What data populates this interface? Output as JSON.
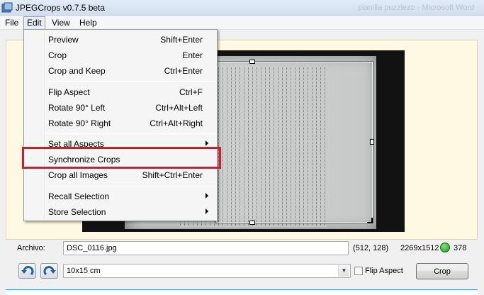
{
  "window": {
    "title": "JPEGCrops v0.7.5 beta",
    "background_title": "planilla puzzlezo - Microsoft Word"
  },
  "menubar": {
    "items": [
      "File",
      "Edit",
      "View",
      "Help"
    ],
    "active": "Edit"
  },
  "edit_menu": {
    "items": [
      {
        "label": "Preview",
        "shortcut": "Shift+Enter"
      },
      {
        "label": "Crop",
        "shortcut": "Enter"
      },
      {
        "label": "Crop and Keep",
        "shortcut": "Ctrl+Enter"
      },
      {
        "label": "Flip Aspect",
        "shortcut": "Ctrl+F"
      },
      {
        "label": "Rotate 90° Left",
        "shortcut": "Ctrl+Alt+Left"
      },
      {
        "label": "Rotate 90° Right",
        "shortcut": "Ctrl+Alt+Right"
      },
      {
        "label": "Set all Aspects",
        "submenu": true
      },
      {
        "label": "Synchronize Crops",
        "highlighted": true
      },
      {
        "label": "Crop all Images",
        "shortcut": "Shift+Ctrl+Enter"
      },
      {
        "label": "Recall Selection",
        "submenu": true
      },
      {
        "label": "Store Selection",
        "submenu": true
      }
    ]
  },
  "file_row": {
    "label": "Archivo:",
    "filename": "DSC_0116.jpg",
    "coords": "(512, 128)",
    "dimensions": "2269x1512",
    "count": "378",
    "status_color": "#2aa62a"
  },
  "controls": {
    "aspect_value": "10x15 cm",
    "flip_aspect_label": "Flip Aspect",
    "flip_aspect_checked": false,
    "crop_button_label": "Crop"
  },
  "colors": {
    "highlight": "#e3132a",
    "preview_background": "#fff9e3"
  }
}
